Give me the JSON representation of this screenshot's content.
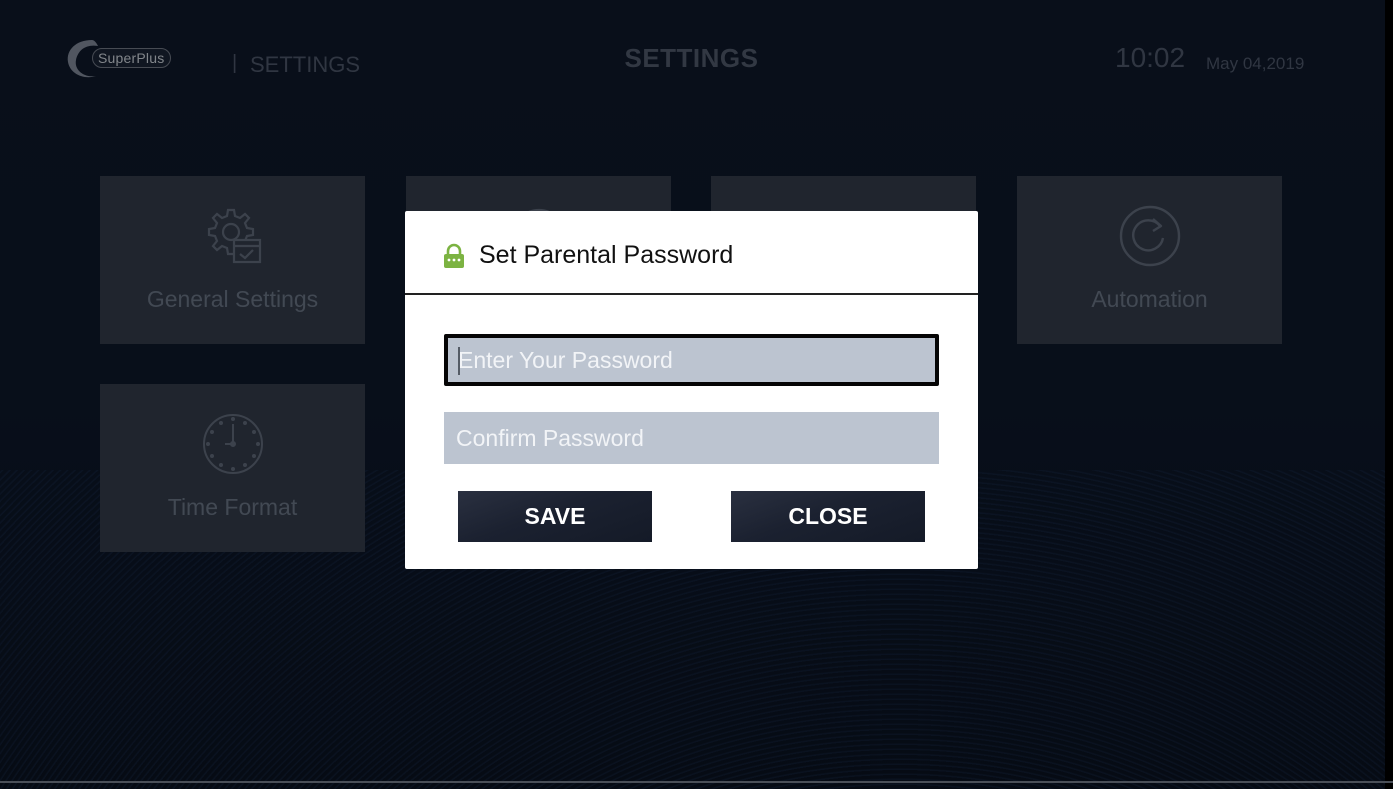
{
  "header": {
    "logo_text": "SuperPlus",
    "divider": "|",
    "crumb": "SETTINGS",
    "title": "SETTINGS",
    "time": "10:02",
    "date": "May 04,2019"
  },
  "tiles": [
    {
      "label": "General Settings",
      "icon": "gear-settings-icon"
    },
    {
      "label": "",
      "icon": "speed-icon"
    },
    {
      "label": "",
      "icon": ""
    },
    {
      "label": "Automation",
      "icon": "refresh-icon"
    },
    {
      "label": "Time Format",
      "icon": "clock-icon"
    }
  ],
  "dialog": {
    "icon": "lock-icon",
    "icon_color": "#7cb342",
    "title": "Set Parental Password",
    "password_placeholder": "Enter Your Password",
    "password_value": "",
    "confirm_placeholder": "Confirm Password",
    "confirm_value": "",
    "save_label": "SAVE",
    "close_label": "CLOSE"
  },
  "colors": {
    "background": "#0e1828",
    "tile": "#323a48",
    "field": "#bcc4d0",
    "button": "#1b2130"
  }
}
